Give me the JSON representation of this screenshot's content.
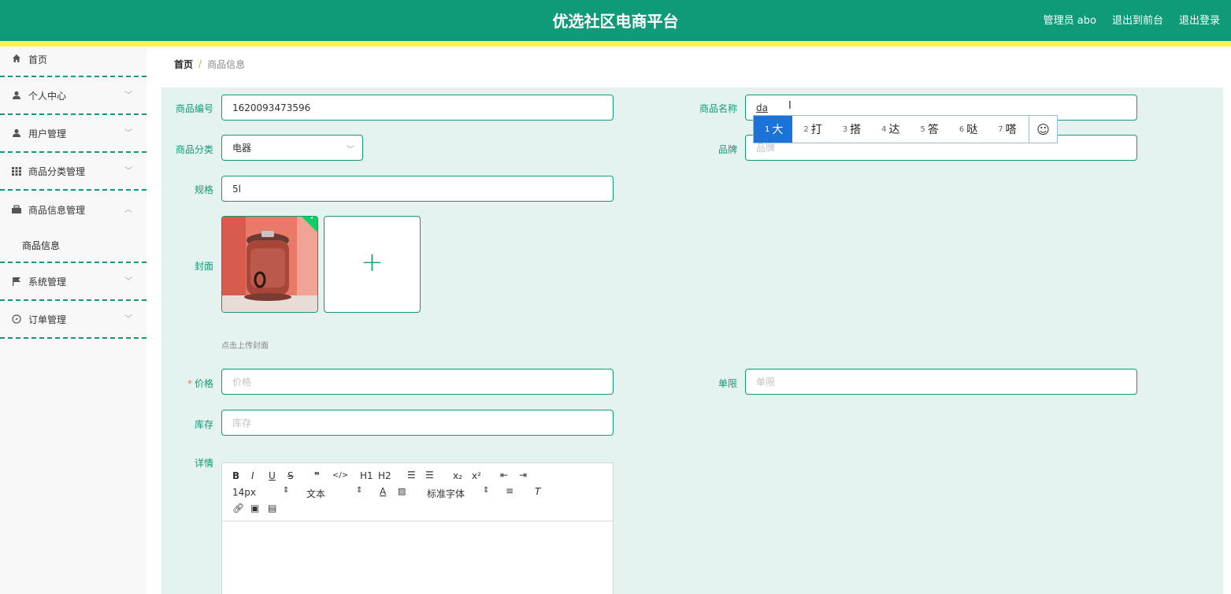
{
  "header": {
    "title": "优选社区电商平台",
    "admin": "管理员 abo",
    "back_front": "退出到前台",
    "logout": "退出登录"
  },
  "sidebar": {
    "items": [
      {
        "label": "首页",
        "icon": "home-icon"
      },
      {
        "label": "个人中心",
        "icon": "user-icon"
      },
      {
        "label": "用户管理",
        "icon": "user-icon"
      },
      {
        "label": "商品分类管理",
        "icon": "grid-icon"
      },
      {
        "label": "商品信息管理",
        "icon": "briefcase-icon",
        "expanded": true,
        "children": [
          "商品信息"
        ]
      },
      {
        "label": "系统管理",
        "icon": "flag-icon"
      },
      {
        "label": "订单管理",
        "icon": "compass-icon"
      }
    ]
  },
  "breadcrumb": {
    "home": "首页",
    "sep": "/",
    "current": "商品信息"
  },
  "form": {
    "code_label": "商品编号",
    "code_value": "1620093473596",
    "name_label": "商品名称",
    "name_value": "da",
    "category_label": "商品分类",
    "category_value": "电器",
    "brand_label": "品牌",
    "brand_placeholder": "品牌",
    "spec_label": "规格",
    "spec_value": "5l",
    "cover_label": "封面",
    "cover_hint": "点击上传封面",
    "price_label": "价格",
    "price_placeholder": "价格",
    "limit_label": "单限",
    "limit_placeholder": "单限",
    "stock_label": "库存",
    "stock_placeholder": "库存",
    "detail_label": "详情"
  },
  "editor": {
    "font_size": "14px",
    "text_type": "文本",
    "font_family": "标准字体",
    "buttons": {
      "bold": "B",
      "italic": "I",
      "underline": "U",
      "strike": "S",
      "quote": "❞",
      "code": "</>",
      "h1": "H1",
      "h2": "H2",
      "sub": "x₂",
      "sup": "x²"
    }
  },
  "ime": {
    "candidates": [
      {
        "n": "1",
        "c": "大"
      },
      {
        "n": "2",
        "c": "打"
      },
      {
        "n": "3",
        "c": "搭"
      },
      {
        "n": "4",
        "c": "达"
      },
      {
        "n": "5",
        "c": "答"
      },
      {
        "n": "6",
        "c": "哒"
      },
      {
        "n": "7",
        "c": "嗒"
      }
    ],
    "emoji": "☺"
  },
  "colors": {
    "primary": "#0f9b78",
    "accent": "#f7f25a",
    "bg": "#e4f3ef",
    "ime_selected": "#1a73d9"
  }
}
